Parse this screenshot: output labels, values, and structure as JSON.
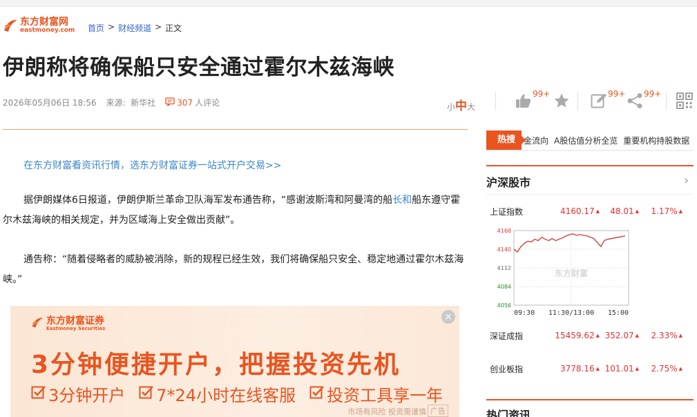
{
  "site": {
    "logo_cn": "东方财富网",
    "logo_en": "eastmoney.com",
    "accent_color": "#e9541f",
    "link_color": "#3366cc"
  },
  "breadcrumb": {
    "home": "首页",
    "sep1": ">",
    "channel": "财经频道",
    "sep2": ">",
    "current": "正文"
  },
  "article": {
    "title": "伊朗称将确保船只安全通过霍尔木兹海峡",
    "datetime": "2026年05月06日 18:56",
    "source_label": "来源:",
    "source": "新华社",
    "comment_count": "307",
    "comment_suffix": "人评论",
    "promo_link": "在东方财富看资讯行情，选东方财富证券一站式开户交易>>",
    "p1_before": "据伊朗媒体6日报道，伊朗伊斯兰革命卫队海军发布通告称，“感谢波斯湾和阿曼湾的船",
    "p1_link": "长和",
    "p1_after": "船东遵守霍尔木兹海峡的相关规定，并为区域海上安全做出贡献”。",
    "p2": "通告称：“随着侵略者的威胁被消除，新的规程已经生效，我们将确保船只安全、稳定地通过霍尔木兹海峡。”"
  },
  "font_size": {
    "small": "小",
    "medium": "中",
    "large": "大"
  },
  "actions": {
    "like_badge": "99+",
    "comment_badge": "99+",
    "share_badge": "99+",
    "icons": [
      "thumbs-up-icon",
      "star-icon",
      "edit-icon",
      "share-icon",
      "qrcode-icon"
    ]
  },
  "ad": {
    "logo_cn": "东方财富证券",
    "logo_en": "Eastmoney Securities",
    "headline": "3分钟便捷开户，把握投资先机",
    "features": [
      "3分钟开户",
      "7*24小时在线客服",
      "投资工具享一年"
    ],
    "close": "×",
    "risk": "市场有风险 投资需谨慎",
    "tag": "广告"
  },
  "hot_search": {
    "tag": "热搜",
    "items": [
      "金流向",
      "A股估值分析全览",
      "重要机构持股数据"
    ]
  },
  "market": {
    "title": "沪深股市",
    "arrow": "›",
    "indices": [
      {
        "name": "上证指数",
        "value": "4160.17",
        "change": "48.01",
        "pct": "1.17%"
      },
      {
        "name": "深证成指",
        "value": "15459.62",
        "change": "352.07",
        "pct": "2.33%"
      },
      {
        "name": "创业板指",
        "value": "3778.16",
        "change": "101.01",
        "pct": "2.75%"
      }
    ],
    "up_marker": "▲",
    "up_color": "#e93030",
    "down_color": "#2a8a2a"
  },
  "chart_data": {
    "type": "line",
    "ylim": [
      4056,
      4168
    ],
    "yticks": [
      "4168",
      "4140",
      "4112",
      "4084",
      "4056"
    ],
    "xticks": [
      "09:30",
      "11:30/13:00",
      "15:00"
    ],
    "watermark": "东方财富",
    "series": [
      {
        "values": [
          4140,
          4136,
          4144,
          4149,
          4152,
          4151,
          4155,
          4153,
          4158,
          4155,
          4153,
          4156,
          4153,
          4155,
          4157,
          4160,
          4162,
          4163,
          4161,
          4162,
          4161,
          4160,
          4158,
          4156,
          4150,
          4144,
          4153,
          4155,
          4156,
          4157,
          4158,
          4159,
          4160
        ]
      }
    ]
  },
  "hot_news": {
    "title": "热门资讯"
  }
}
